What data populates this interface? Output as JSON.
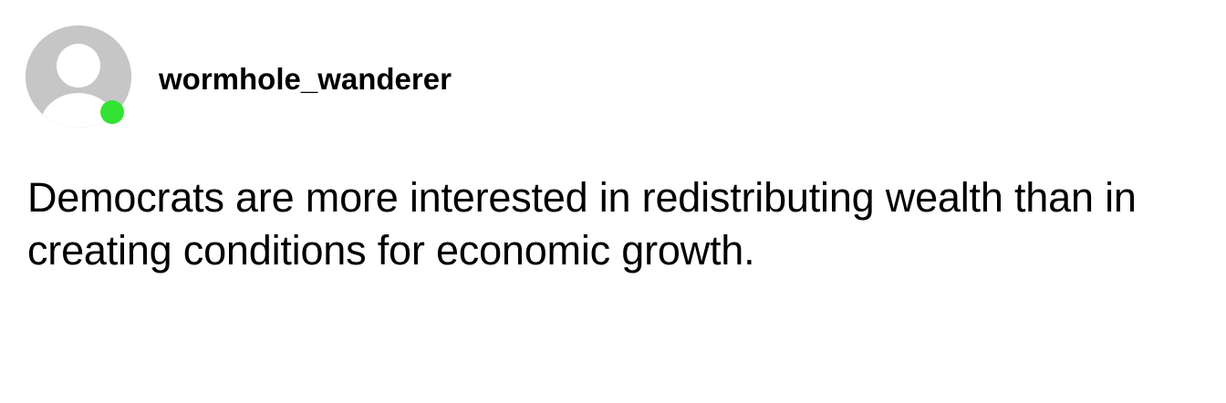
{
  "post": {
    "author": {
      "username": "wormhole_wanderer",
      "online": true,
      "avatar_icon": "default-user-icon",
      "status_color": "#34e234"
    },
    "text": "Democrats are more interested in redistributing wealth than in creating conditions for economic growth."
  }
}
